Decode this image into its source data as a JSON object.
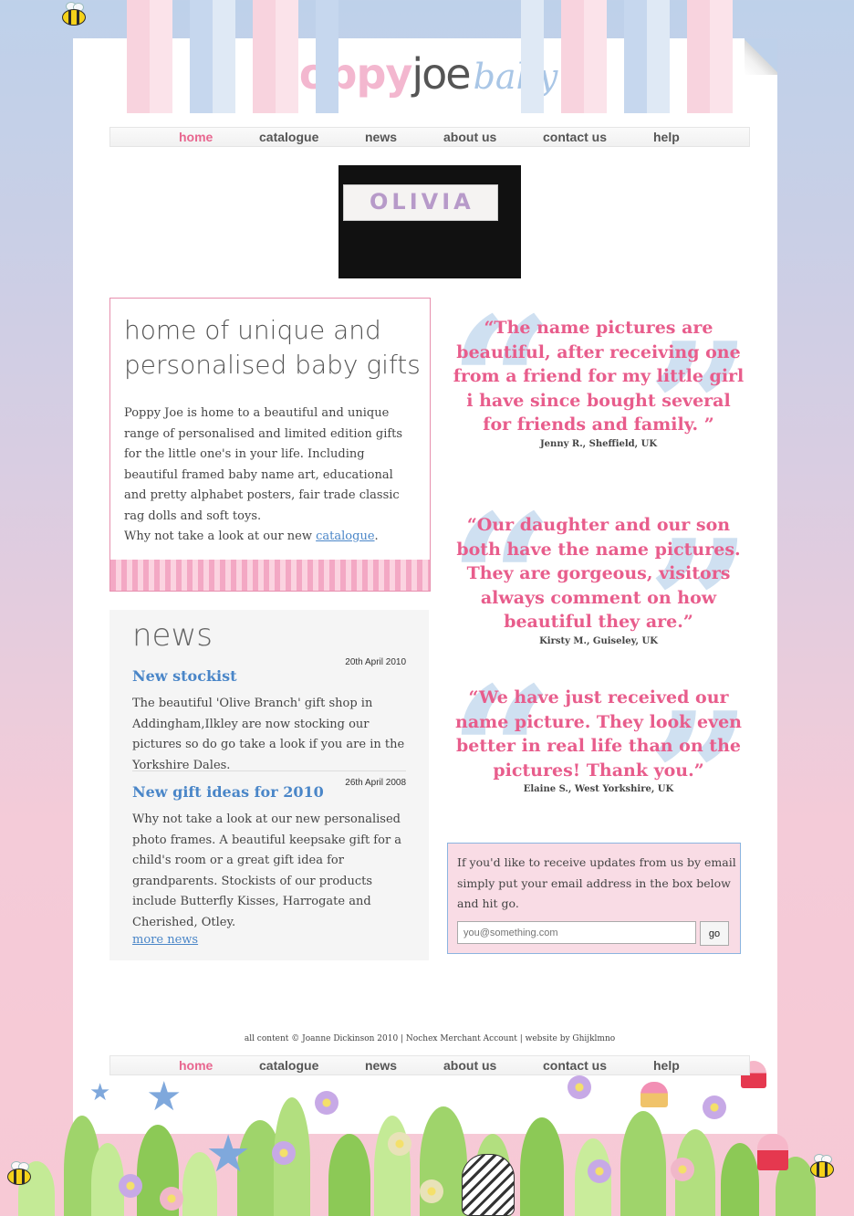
{
  "brand": {
    "poppy": "poppy",
    "joe": "joe",
    "baby": "baby"
  },
  "nav": {
    "items": [
      {
        "label": "home",
        "active": true
      },
      {
        "label": "catalogue"
      },
      {
        "label": "news"
      },
      {
        "label": "about us"
      },
      {
        "label": "contact us"
      },
      {
        "label": "help"
      }
    ]
  },
  "banner": {
    "name": "OLIVIA"
  },
  "intro": {
    "title": "home of unique and personalised baby gifts",
    "body": "Poppy Joe is home to a beautiful and unique range of personalised and limited edition gifts for the little one's in your life. Including beautiful framed baby name art, educational and pretty alphabet posters, fair trade classic rag dolls and soft toys.",
    "cta_prefix": "Why not take a look at our new ",
    "cta_link": "catalogue",
    "cta_suffix": "."
  },
  "news": {
    "title": "news",
    "items": [
      {
        "date": "20th April 2010",
        "headline": "New stockist",
        "text": "The beautiful 'Olive Branch' gift shop in Addingham,Ilkley are now stocking our pictures so do go take a look if you are in the Yorkshire Dales."
      },
      {
        "date": "26th April 2008",
        "headline": "New gift ideas for 2010",
        "text": "Why not take a look at our new personalised photo frames. A beautiful keepsake gift for a child's room or a great gift idea for grandparents. Stockists of our products include Butterfly Kisses, Harrogate and Cherished, Otley."
      }
    ],
    "more": "more news"
  },
  "testimonials": [
    {
      "text": "“The name pictures are beautiful, after receiving one from a friend for my little girl i have since bought several for friends and family. ”",
      "name": "Jenny R., Sheffield, UK"
    },
    {
      "text": "“Our daughter and our son both have the name pictures. They are gorgeous, visitors always comment on how beautiful they are.”",
      "name": "Kirsty M., Guiseley, UK"
    },
    {
      "text": "“We have just received our name picture. They look even better in real life than on the pictures! Thank you.”",
      "name": "Elaine S., West Yorkshire, UK"
    }
  ],
  "signup": {
    "text": "If you'd like to receive updates from us by email simply put your email address in the box below and hit go.",
    "placeholder": "you@something.com",
    "button": "go"
  },
  "footer": {
    "prefix": "all content © Joanne Dickinson 2010 | Nochex ",
    "link1": "Merchant Account",
    "middle": " | website by ",
    "link2": "Ghijklmno"
  },
  "colors": {
    "pink_accent": "#e85d8c",
    "blue_link": "#4a86c8",
    "logo_pink": "#f3b7cf",
    "logo_blue": "#a9c6e6"
  }
}
